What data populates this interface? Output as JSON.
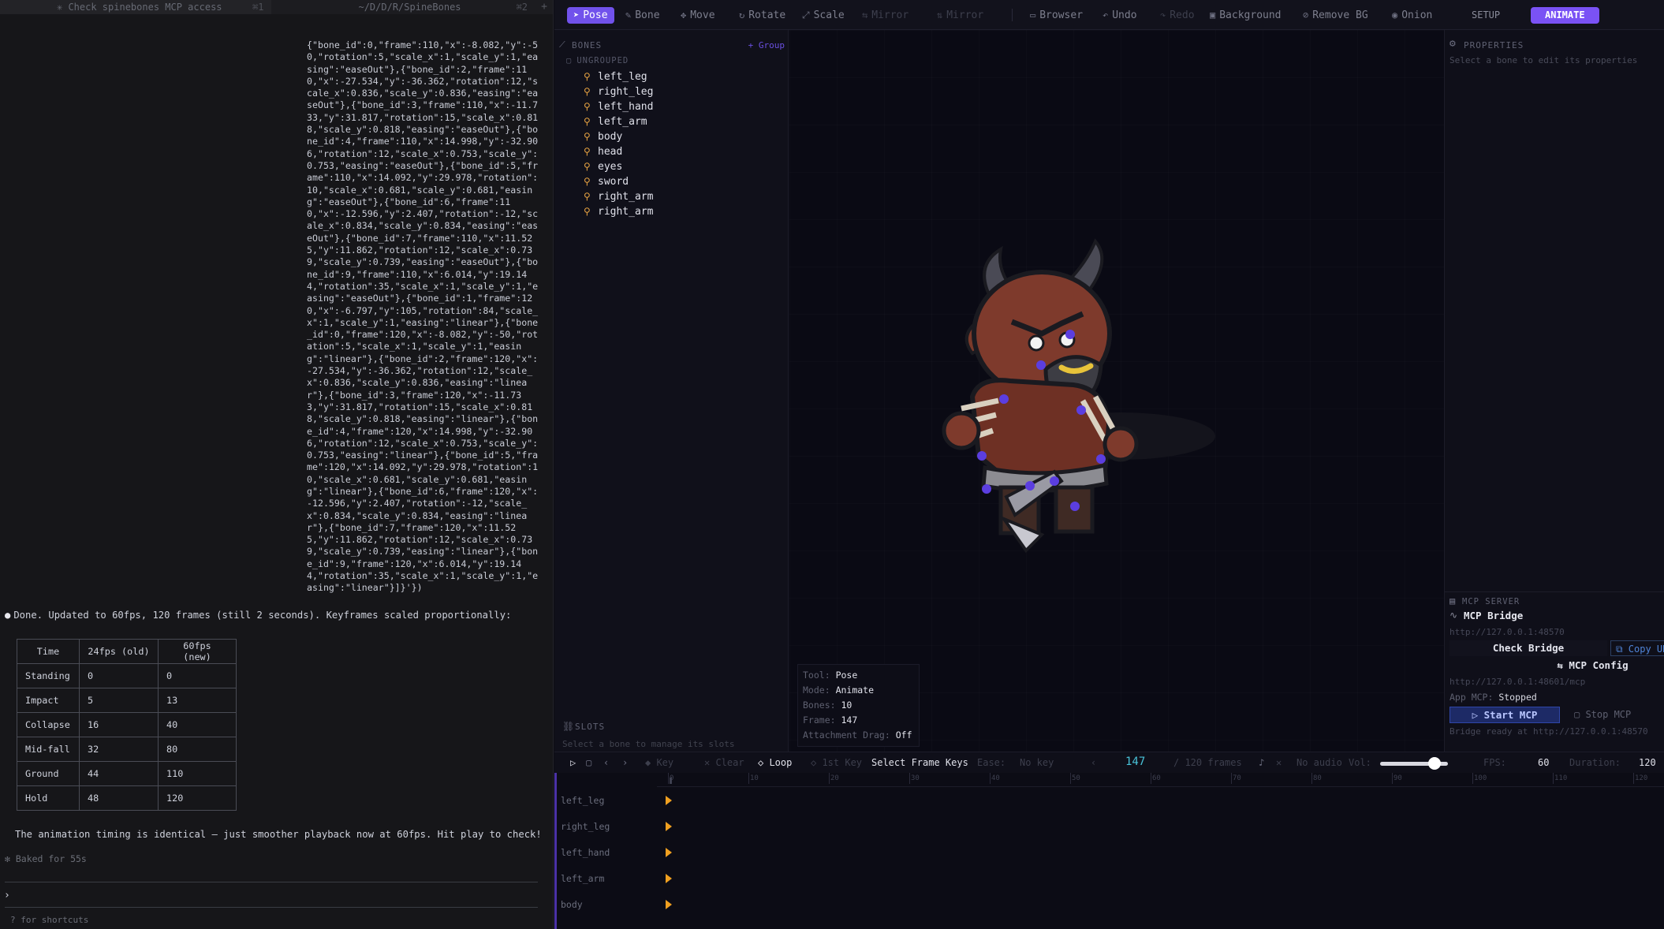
{
  "terminal": {
    "tabs": [
      {
        "label": "✳ Check spinebones MCP access",
        "shortcut": "⌘1"
      },
      {
        "label": "~/D/D/R/SpineBones",
        "shortcut": "⌘2"
      }
    ],
    "tab_plus": "+",
    "json_output": "{\"bone_id\":0,\"frame\":110,\"x\":-8.082,\"y\":-50,\"rotation\":5,\"scale_x\":1,\"scale_y\":1,\"easing\":\"easeOut\"},{\"bone_id\":2,\"frame\":110,\"x\":-27.534,\"y\":-36.362,\"rotation\":12,\"scale_x\":0.836,\"scale_y\":0.836,\"easing\":\"easeOut\"},{\"bone_id\":3,\"frame\":110,\"x\":-11.733,\"y\":31.817,\"rotation\":15,\"scale_x\":0.818,\"scale_y\":0.818,\"easing\":\"easeOut\"},{\"bone_id\":4,\"frame\":110,\"x\":14.998,\"y\":-32.906,\"rotation\":12,\"scale_x\":0.753,\"scale_y\":0.753,\"easing\":\"easeOut\"},{\"bone_id\":5,\"frame\":110,\"x\":14.092,\"y\":29.978,\"rotation\":10,\"scale_x\":0.681,\"scale_y\":0.681,\"easing\":\"easeOut\"},{\"bone_id\":6,\"frame\":110,\"x\":-12.596,\"y\":2.407,\"rotation\":-12,\"scale_x\":0.834,\"scale_y\":0.834,\"easing\":\"easeOut\"},{\"bone_id\":7,\"frame\":110,\"x\":11.525,\"y\":11.862,\"rotation\":12,\"scale_x\":0.739,\"scale_y\":0.739,\"easing\":\"easeOut\"},{\"bone_id\":9,\"frame\":110,\"x\":6.014,\"y\":19.144,\"rotation\":35,\"scale_x\":1,\"scale_y\":1,\"easing\":\"easeOut\"},{\"bone_id\":1,\"frame\":120,\"x\":-6.797,\"y\":105,\"rotation\":84,\"scale_x\":1,\"scale_y\":1,\"easing\":\"linear\"},{\"bone_id\":0,\"frame\":120,\"x\":-8.082,\"y\":-50,\"rotation\":5,\"scale_x\":1,\"scale_y\":1,\"easing\":\"linear\"},{\"bone_id\":2,\"frame\":120,\"x\":-27.534,\"y\":-36.362,\"rotation\":12,\"scale_x\":0.836,\"scale_y\":0.836,\"easing\":\"linear\"},{\"bone_id\":3,\"frame\":120,\"x\":-11.733,\"y\":31.817,\"rotation\":15,\"scale_x\":0.818,\"scale_y\":0.818,\"easing\":\"linear\"},{\"bone_id\":4,\"frame\":120,\"x\":14.998,\"y\":-32.906,\"rotation\":12,\"scale_x\":0.753,\"scale_y\":0.753,\"easing\":\"linear\"},{\"bone_id\":5,\"frame\":120,\"x\":14.092,\"y\":29.978,\"rotation\":10,\"scale_x\":0.681,\"scale_y\":0.681,\"easing\":\"linear\"},{\"bone_id\":6,\"frame\":120,\"x\":-12.596,\"y\":2.407,\"rotation\":-12,\"scale_x\":0.834,\"scale_y\":0.834,\"easing\":\"linear\"},{\"bone_id\":7,\"frame\":120,\"x\":11.525,\"y\":11.862,\"rotation\":12,\"scale_x\":0.739,\"scale_y\":0.739,\"easing\":\"linear\"},{\"bone_id\":9,\"frame\":120,\"x\":6.014,\"y\":19.144,\"rotation\":35,\"scale_x\":1,\"scale_y\":1,\"easing\":\"linear\"}]}'})",
    "done_bullet": "●",
    "done_text": "Done. Updated to 60fps, 120 frames (still 2 seconds). Keyframes scaled proportionally:",
    "table": {
      "headers": [
        "Time",
        "24fps (old)",
        "60fps (new)"
      ],
      "rows": [
        [
          "Standing",
          "0",
          "0"
        ],
        [
          "Impact",
          "5",
          "13"
        ],
        [
          "Collapse",
          "16",
          "40"
        ],
        [
          "Mid-fall",
          "32",
          "80"
        ],
        [
          "Ground",
          "44",
          "110"
        ],
        [
          "Hold",
          "48",
          "120"
        ]
      ]
    },
    "identical_text": "The animation timing is identical — just smoother playback now at 60fps. Hit play to check!",
    "baked_text": "✻ Baked for 55s",
    "prompt": "›",
    "shortcuts_text": "? for shortcuts"
  },
  "toolbar": {
    "pose": "Pose",
    "bone": "Bone",
    "move": "Move",
    "rotate": "Rotate",
    "scale": "Scale",
    "mirror": "Mirror",
    "mirror2": "Mirror",
    "browser": "Browser",
    "undo": "Undo",
    "redo": "Redo",
    "background": "Background",
    "remove_bg": "Remove BG",
    "onion": "Onion",
    "setup": "SETUP",
    "animate": "ANIMATE"
  },
  "bones_panel": {
    "title": "BONES",
    "group_button": "+ Group",
    "ungrouped": "UNGROUPED",
    "items": [
      "left_leg",
      "right_leg",
      "left_hand",
      "left_arm",
      "body",
      "head",
      "eyes",
      "sword",
      "right_arm",
      "right_arm"
    ],
    "slots_title": "SLOTS",
    "slots_hint": "Select a bone to manage its slots"
  },
  "viewport_info": {
    "tool_label": "Tool:",
    "tool": "Pose",
    "mode_label": "Mode:",
    "mode": "Animate",
    "bones_label": "Bones:",
    "bones": "10",
    "frame_label": "Frame:",
    "frame": "147",
    "attach_label": "Attachment Drag:",
    "attach": "Off"
  },
  "properties": {
    "title": "PROPERTIES",
    "hint": "Select a bone to edit its properties"
  },
  "mcp": {
    "section": "MCP SERVER",
    "title": "MCP Bridge",
    "url": "http://127.0.0.1:48570",
    "check": "Check Bridge",
    "copy": "Copy URL",
    "config": "MCP Config",
    "url2": "http://127.0.0.1:48601/mcp",
    "app_mcp_label": "App MCP:",
    "app_mcp_status": "Stopped",
    "start": "Start MCP",
    "stop": "Stop MCP",
    "ready": "Bridge ready at http://127.0.0.1:48570"
  },
  "transport": {
    "key": "Key",
    "clear": "Clear",
    "loop": "Loop",
    "first_key": "1st Key",
    "select_frame_keys": "Select Frame Keys",
    "ease_label": "Ease:",
    "ease_value": "No key",
    "frame": "147",
    "frames_total": "/ 120 frames",
    "no_audio": "No audio",
    "vol_label": "Vol:",
    "volume": 0.8,
    "fps_label": "FPS:",
    "fps": "60",
    "duration_label": "Duration:",
    "duration": "120"
  },
  "timeline": {
    "ticks": [
      "0",
      "10",
      "20",
      "30",
      "40",
      "50",
      "60",
      "70",
      "80",
      "90",
      "100",
      "110",
      "120"
    ],
    "rows": [
      "left_leg",
      "right_leg",
      "left_hand",
      "left_arm",
      "body"
    ]
  },
  "colors": {
    "accent": "#7152ec",
    "keyframe": "#f0a020",
    "bone_icon": "#e3a042",
    "frame_counter": "#48c2d8"
  }
}
